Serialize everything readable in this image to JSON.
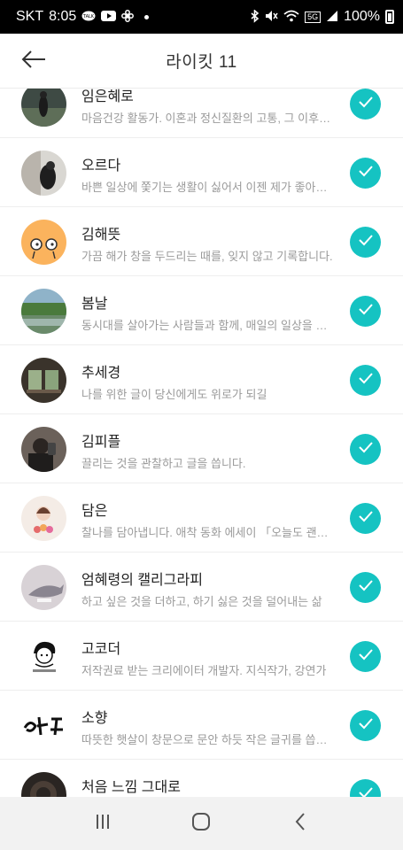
{
  "status_bar": {
    "carrier": "SKT",
    "time": "8:05",
    "battery": "100%",
    "network": "5G"
  },
  "header": {
    "title": "라이킷 11",
    "back_icon": "arrow-left-icon"
  },
  "colors": {
    "accent": "#15c3c2",
    "name_text": "#222222",
    "desc_text": "#9a9a9a",
    "divider": "#eeeeee"
  },
  "items": [
    {
      "name": "임은혜로",
      "desc": "마음건강 활동가. 이혼과 정신질환의 고통, 그 이후를 기록합니다.",
      "avatar": "photo-dark-figure",
      "checked": true
    },
    {
      "name": "오르다",
      "desc": "바쁜 일상에 쫓기는 생활이 싫어서 이젠 제가 좋아하는 일을 합니다.",
      "avatar": "photo-person-wall",
      "checked": true
    },
    {
      "name": "김해뜻",
      "desc": "가끔 해가 창을 두드리는 때를, 잊지 않고 기록합니다.",
      "avatar": "illustration-orange-face",
      "checked": true
    },
    {
      "name": "봄날",
      "desc": "동시대를 살아가는 사람들과 함께, 매일의 일상을 나눕니다.",
      "avatar": "photo-lake",
      "checked": true
    },
    {
      "name": "추세경",
      "desc": "나를 위한 글이 당신에게도 위로가 되길",
      "avatar": "photo-window",
      "checked": true
    },
    {
      "name": "김피플",
      "desc": "끌리는 것을 관찰하고 글을 씁니다.",
      "avatar": "photo-selfie",
      "checked": true
    },
    {
      "name": "담은",
      "desc": "찰나를 담아냅니다. 애착 동화 에세이 「오늘도 괜찮아」",
      "avatar": "illustration-girl-flowers",
      "checked": true
    },
    {
      "name": "엄혜령의 캘리그라피",
      "desc": "하고 싶은 것을 더하고, 하기 싫은 것을 덜어내는 삶",
      "avatar": "photo-whale",
      "checked": true
    },
    {
      "name": "고코더",
      "desc": "저작권료 받는 크리에이터 개발자. 지식작가, 강연가",
      "avatar": "illustration-gocoder",
      "checked": true
    },
    {
      "name": "소향",
      "desc": "따뜻한 햇살이 창문으로 문안 하듯 작은 글귀를 씁니다.",
      "avatar": "calligraphy-sohyang",
      "checked": true
    },
    {
      "name": "처음 느낌 그대로",
      "desc": "",
      "avatar": "photo-dark-circle",
      "checked": true
    }
  ],
  "nav_bar": {
    "recent_icon": "recent-apps-icon",
    "home_icon": "home-icon",
    "back_icon": "back-chevron-icon"
  }
}
